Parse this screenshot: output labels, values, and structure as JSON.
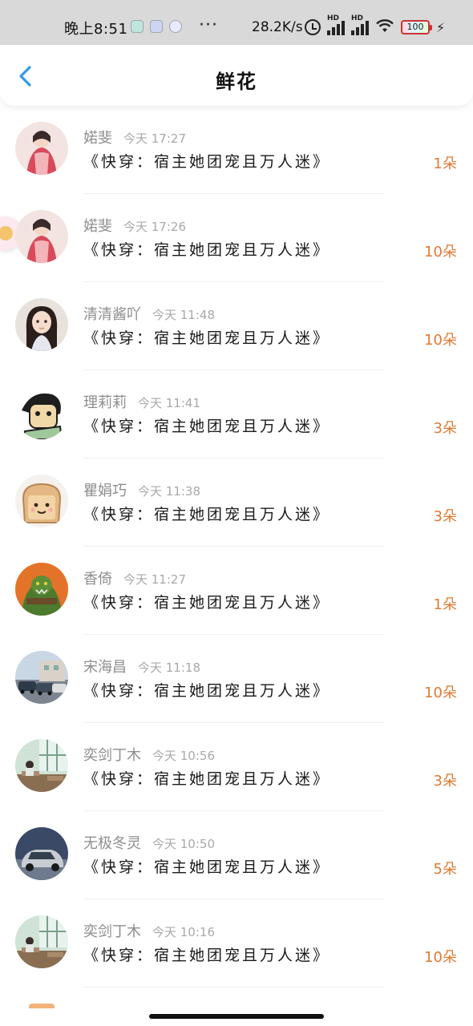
{
  "status_bar": {
    "time": "晚上8:51",
    "dots": "···",
    "net_speed": "28.2K/s",
    "battery": "100",
    "icons": [
      "app-icon-1",
      "app-icon-2",
      "app-icon-3",
      "alarm-icon",
      "hd-signal-icon",
      "hd-signal-icon",
      "wifi-icon",
      "battery-icon",
      "charging-icon"
    ]
  },
  "header": {
    "title": "鲜花",
    "back_icon": "chevron-left-icon"
  },
  "colors": {
    "accent_blue": "#2f9ae9",
    "count_orange": "#e07a32"
  },
  "entries": [
    {
      "name": "婼斐",
      "time": "今天 17:27",
      "book": "《快穿：宿主她团宠且万人迷》",
      "count": "1朵",
      "avatar": "avatar-girl-red-dress"
    },
    {
      "name": "婼斐",
      "time": "今天 17:26",
      "book": "《快穿：宿主她团宠且万人迷》",
      "count": "10朵",
      "avatar": "avatar-girl-red-dress"
    },
    {
      "name": "清清酱吖",
      "time": "今天 11:48",
      "book": "《快穿：宿主她团宠且万人迷》",
      "count": "10朵",
      "avatar": "avatar-girl-dark-hair"
    },
    {
      "name": "理莉莉",
      "time": "今天 11:41",
      "book": "《快穿：宿主她团宠且万人迷》",
      "count": "3朵",
      "avatar": "avatar-cartoon-character"
    },
    {
      "name": "瞿娟巧",
      "time": "今天 11:38",
      "book": "《快穿：宿主她团宠且万人迷》",
      "count": "3朵",
      "avatar": "avatar-toast-face"
    },
    {
      "name": "香倚",
      "time": "今天 11:27",
      "book": "《快穿：宿主她团宠且万人迷》",
      "count": "1朵",
      "avatar": "avatar-green-monster"
    },
    {
      "name": "宋海昌",
      "time": "今天 11:18",
      "book": "《快穿：宿主她团宠且万人迷》",
      "count": "10朵",
      "avatar": "avatar-parked-cars"
    },
    {
      "name": "奕剑丁木",
      "time": "今天 10:56",
      "book": "《快穿：宿主她团宠且万人迷》",
      "count": "3朵",
      "avatar": "avatar-classroom-scene"
    },
    {
      "name": "无极冬灵",
      "time": "今天 10:50",
      "book": "《快穿：宿主她团宠且万人迷》",
      "count": "5朵",
      "avatar": "avatar-silver-car"
    },
    {
      "name": "奕剑丁木",
      "time": "今天 10:16",
      "book": "《快穿：宿主她团宠且万人迷》",
      "count": "10朵",
      "avatar": "avatar-classroom-scene"
    }
  ]
}
